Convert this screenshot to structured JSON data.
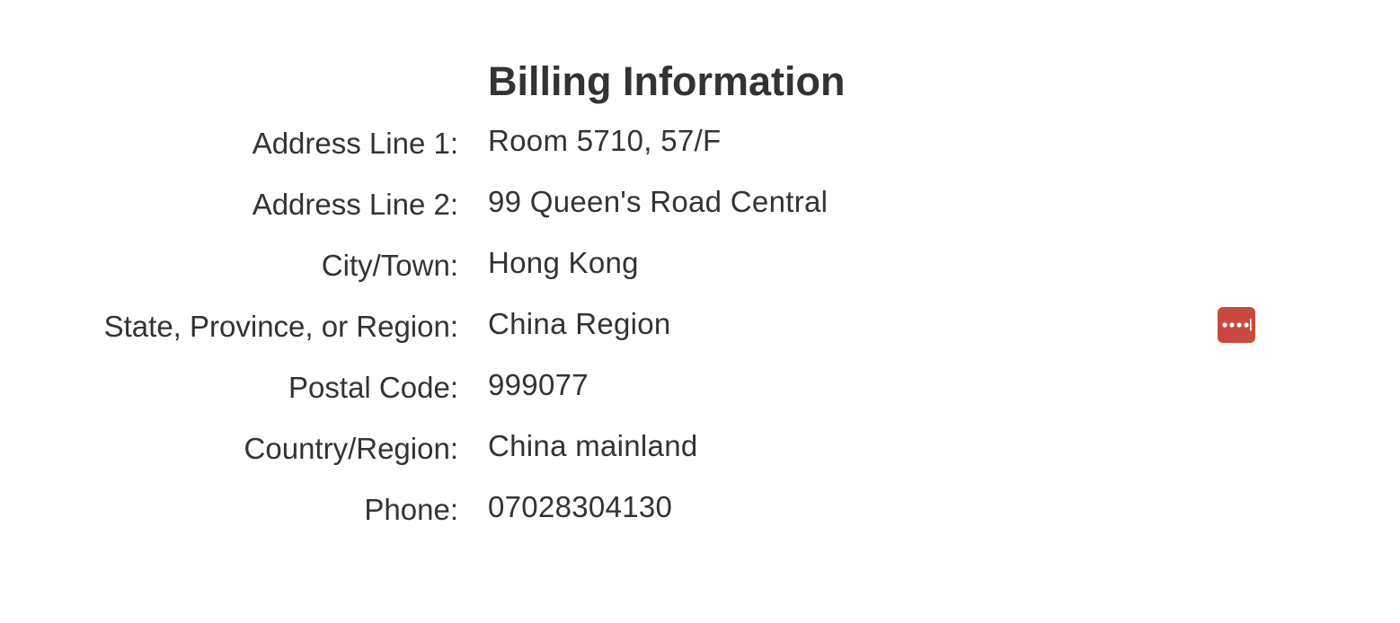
{
  "heading": "Billing Information",
  "fields": [
    {
      "label": "Address Line 1:",
      "value": "Room 5710, 57/F"
    },
    {
      "label": "Address Line 2:",
      "value": "99 Queen's Road Central"
    },
    {
      "label": "City/Town:",
      "value": "Hong Kong"
    },
    {
      "label": "State, Province, or Region:",
      "value": "China Region"
    },
    {
      "label": "Postal Code:",
      "value": "999077"
    },
    {
      "label": "Country/Region:",
      "value": "China mainland"
    },
    {
      "label": "Phone:",
      "value": "07028304130"
    }
  ],
  "password_manager": {
    "icon": "password-manager-icon",
    "color": "#c84a3f"
  }
}
